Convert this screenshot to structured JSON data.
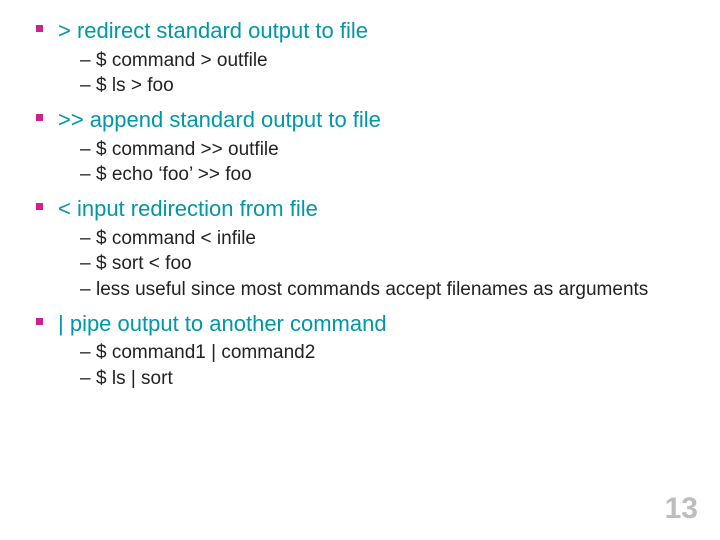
{
  "page_number": "13",
  "items": [
    {
      "heading": "> redirect standard output to file",
      "subs": [
        "$ command > outfile",
        "$ ls > foo"
      ]
    },
    {
      "heading": ">> append standard output to file",
      "subs": [
        "$ command >> outfile",
        "$ echo ‘foo’ >> foo"
      ]
    },
    {
      "heading": "< input redirection from file",
      "subs": [
        "$ command < infile",
        "$ sort < foo",
        "less useful since most commands accept filenames as arguments"
      ]
    },
    {
      "heading": "| pipe output to another command",
      "subs": [
        "$ command1 | command2",
        "$ ls | sort"
      ]
    }
  ]
}
